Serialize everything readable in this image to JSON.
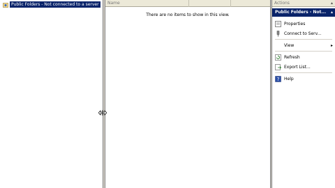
{
  "tree": {
    "selected_node": "Public Folders - Not connected to a server"
  },
  "list": {
    "columns": [
      "Name",
      "",
      ""
    ],
    "empty_message": "There are no items to show in this view."
  },
  "actions": {
    "title": "Actions",
    "section_title": "Public Folders - Not...",
    "items": [
      {
        "label": "Properties",
        "icon": "properties-icon"
      },
      {
        "label": "Connect to Serv...",
        "icon": "connect-icon"
      },
      {
        "label": "View",
        "icon": "",
        "submenu": true
      },
      {
        "label": "Refresh",
        "icon": "refresh-icon"
      },
      {
        "label": "Export List...",
        "icon": "export-icon"
      },
      {
        "label": "Help",
        "icon": "help-icon"
      }
    ]
  },
  "colors": {
    "selection": "#0a246a",
    "window": "#d4d0c8"
  }
}
